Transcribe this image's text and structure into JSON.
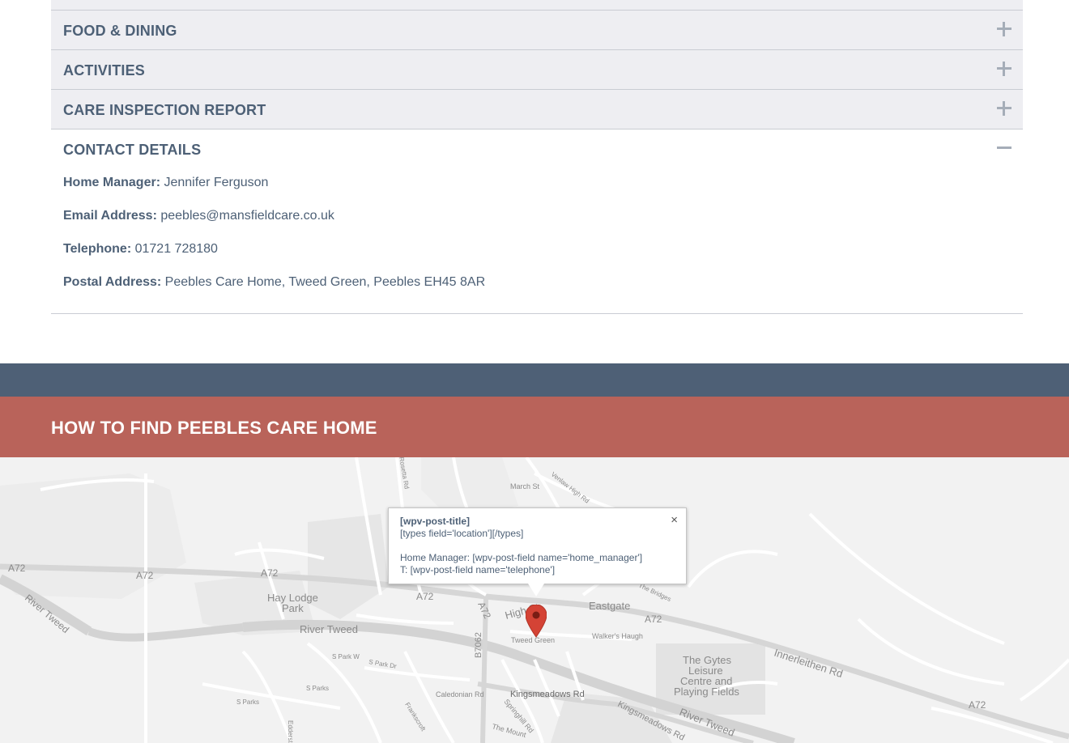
{
  "accordion": {
    "items": [
      {
        "label": "FOOD & DINING"
      },
      {
        "label": "ACTIVITIES"
      },
      {
        "label": "CARE INSPECTION REPORT"
      }
    ],
    "open_item": {
      "label": "CONTACT DETAILS",
      "details": {
        "manager_label": "Home Manager:",
        "manager_value": "Jennifer Ferguson",
        "email_label": "Email Address:",
        "email_value": "peebles@mansfieldcare.co.uk",
        "phone_label": "Telephone:",
        "phone_value": "01721 728180",
        "postal_label": "Postal Address:",
        "postal_value": "Peebles Care Home, Tweed Green, Peebles EH45 8AR"
      }
    }
  },
  "find_section": {
    "heading": "HOW TO FIND PEEBLES CARE HOME"
  },
  "map": {
    "infowindow": {
      "title": "[wpv-post-title]",
      "location": "[types field='location'][/types]",
      "manager": "Home Manager: [wpv-post-field name='home_manager']",
      "telephone": "T: [wpv-post-field name='telephone']",
      "close_symbol": "×"
    },
    "labels": {
      "a72_1": "A72",
      "a72_2": "A72",
      "a72_3": "A72",
      "a72_4": "A72",
      "a72_5": "A72",
      "a72_6": "A72",
      "a72_7": "A72",
      "hay_lodge_1": "Hay Lodge",
      "hay_lodge_2": "Park",
      "river_tweed_1": "River Tweed",
      "river_tweed_2": "River Tweed",
      "river_tweed_3": "River Tweed",
      "eastgate": "Eastgate",
      "high_st": "High St",
      "tweed_green": "Tweed Green",
      "walkers_haugh": "Walker's Haugh",
      "innerleithen": "Innerleithen Rd",
      "gytes_1": "The Gytes",
      "gytes_2": "Leisure",
      "gytes_3": "Centre and",
      "gytes_4": "Playing Fields",
      "kingsmeadows_1": "Kingsmeadows Rd",
      "kingsmeadows_2": "Kingsmeadows Rd",
      "b7062": "B7062",
      "march_st": "March St",
      "venlaw": "Venlaw High Rd",
      "the_bridges": "The Bridges",
      "caledonian": "Caledonian Rd",
      "springhill": "Springhill Rd",
      "the_mount": "The Mount",
      "frankscroft": "Frankscroft",
      "s_park_w": "S Park W",
      "s_park_dr": "S Park Dr",
      "s_parks_1": "S Parks",
      "s_parks_2": "S Parks",
      "edderston": "Edderston",
      "rosetta": "Rosetta Rd"
    },
    "colors": {
      "land": "#f2f2f2",
      "road": "#ffffff",
      "major_road": "#d6d6d6",
      "river": "#d3d3d3",
      "block": "#e3e3e3",
      "pin": "#d44335"
    }
  },
  "colors": {
    "text": "#4d6076",
    "accordion_bg": "#eeeef2",
    "dark_band": "#4e6076",
    "red_band": "#b9635a"
  }
}
